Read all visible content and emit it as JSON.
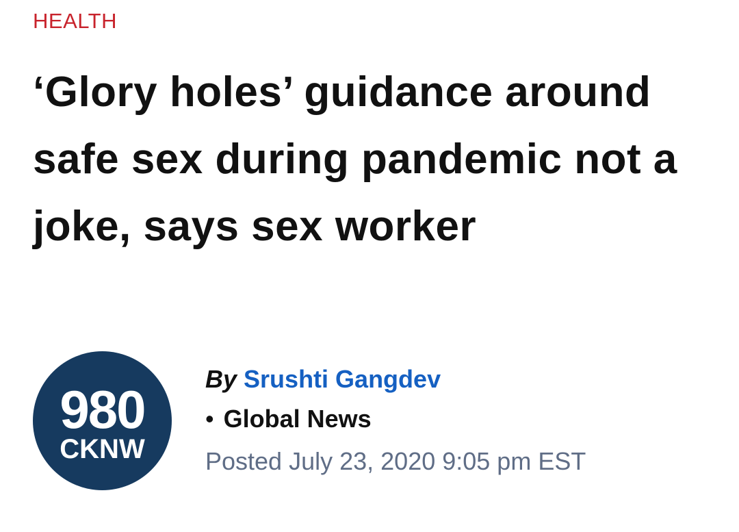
{
  "article": {
    "category": "HEALTH",
    "headline": "‘Glory holes’ guidance around safe sex during pandemic not a joke, says sex worker",
    "logo": {
      "number": "980",
      "callsign": "CKNW",
      "color": "#163a5f"
    },
    "byline": {
      "by_label": "By",
      "author": "Srushti Gangdev",
      "bullet": "•",
      "source": "Global News",
      "posted": "Posted July 23, 2020 9:05 pm EST"
    }
  },
  "colors": {
    "category": "#c8232c",
    "author_link": "#1560c2",
    "posted_text": "#5f6d86"
  }
}
